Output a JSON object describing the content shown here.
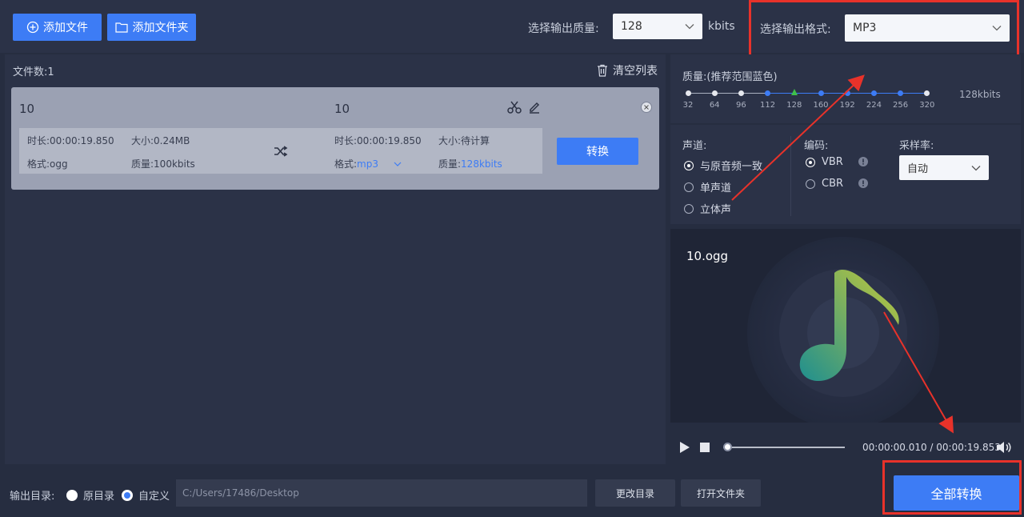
{
  "toolbar": {
    "add_file": "添加文件",
    "add_folder": "添加文件夹",
    "quality_label": "选择输出质量:",
    "quality_value": "128",
    "quality_unit": "kbits",
    "format_label": "选择输出格式:",
    "format_value": "MP3"
  },
  "filelist": {
    "count_label": "文件数:1",
    "clear_label": "清空列表",
    "item": {
      "src_name": "10",
      "dst_name": "10",
      "src_duration": "时长:00:00:19.850",
      "src_size": "大小:0.24MB",
      "src_format": "格式:ogg",
      "src_quality": "质量:100kbits",
      "dst_duration": "时长:00:00:19.850",
      "dst_size": "大小:待计算",
      "dst_format_label": "格式:",
      "dst_format_value": "mp3",
      "dst_quality_label": "质量:",
      "dst_quality_value": "128kbits",
      "convert_label": "转换"
    }
  },
  "settings": {
    "quality_title": "质量:(推荐范围蓝色)",
    "quality_ticks": [
      "32",
      "64",
      "96",
      "112",
      "128",
      "160",
      "192",
      "224",
      "256",
      "320"
    ],
    "quality_current": "128kbits",
    "channel_title": "声道:",
    "channel_options": [
      "与原音频一致",
      "单声道",
      "立体声"
    ],
    "encoding_title": "编码:",
    "encoding_options": [
      "VBR",
      "CBR"
    ],
    "samplerate_title": "采样率:",
    "samplerate_value": "自动"
  },
  "preview": {
    "filename": "10.ogg",
    "time": "00:00:00.010 / 00:00:19.853"
  },
  "bottom": {
    "output_label": "输出目录:",
    "opt_original": "原目录",
    "opt_custom": "自定义",
    "path": "C:/Users/17486/Desktop",
    "change_dir": "更改目录",
    "open_folder": "打开文件夹",
    "convert_all": "全部转换"
  },
  "colors": {
    "accent": "#3d7cf5",
    "annotation": "#e8322a"
  }
}
